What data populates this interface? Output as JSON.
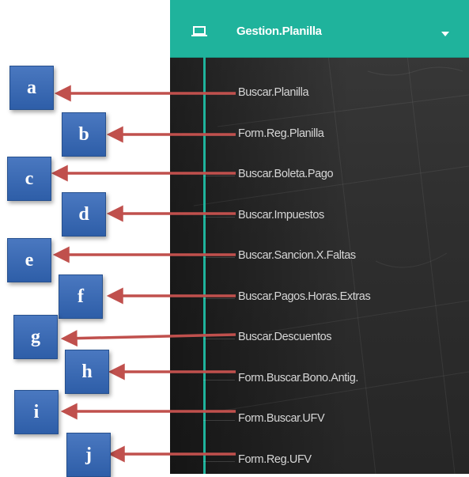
{
  "menu": {
    "title": "Gestion.Planilla",
    "icon": "laptop-icon",
    "expand_icon": "caret-down-icon",
    "accent_color": "#1fb39c",
    "items": [
      {
        "label": "Buscar.Planilla"
      },
      {
        "label": "Form.Reg.Planilla"
      },
      {
        "label": "Buscar.Boleta.Pago"
      },
      {
        "label": "Buscar.Impuestos"
      },
      {
        "label": "Buscar.Sancion.X.Faltas"
      },
      {
        "label": "Buscar.Pagos.Horas.Extras"
      },
      {
        "label": "Buscar.Descuentos"
      },
      {
        "label": "Form.Buscar.Bono.Antig."
      },
      {
        "label": "Form.Buscar.UFV"
      },
      {
        "label": "Form.Reg.UFV"
      }
    ]
  },
  "callouts": [
    "a",
    "b",
    "c",
    "d",
    "e",
    "f",
    "g",
    "h",
    "i",
    "j"
  ],
  "callout_color": "#3a69b4",
  "arrow_color": "#c0504d"
}
